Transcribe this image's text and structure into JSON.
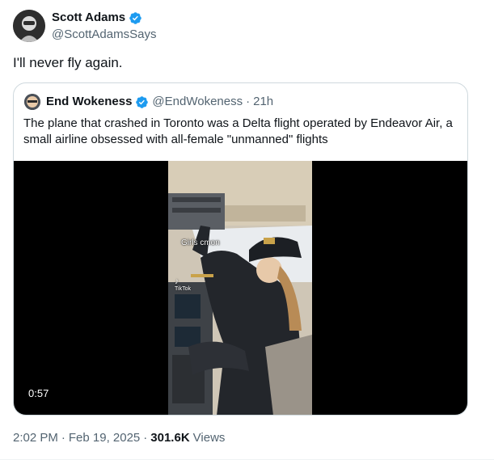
{
  "author": {
    "name": "Scott Adams",
    "handle": "@ScottAdamsSays",
    "verified": true
  },
  "tweet": {
    "text": "I'll never fly again."
  },
  "quoted": {
    "name": "End Wokeness",
    "handle": "@EndWokeness",
    "separator": "·",
    "time": "21h",
    "text": "The plane that crashed in Toronto was a Delta flight operated by Endeavor Air, a small airline obsessed with all-female \"unmanned\" flights",
    "video": {
      "caption": "Girls cmon",
      "watermark": "TikTok",
      "duration": "0:57"
    }
  },
  "footer": {
    "time": "2:02 PM",
    "separator": "·",
    "date": "Feb 19, 2025",
    "views_count": "301.6K",
    "views_label": "Views"
  },
  "colors": {
    "verified_badge": "#1d9bf0",
    "secondary_text": "#536471",
    "border": "#cfd9de"
  }
}
